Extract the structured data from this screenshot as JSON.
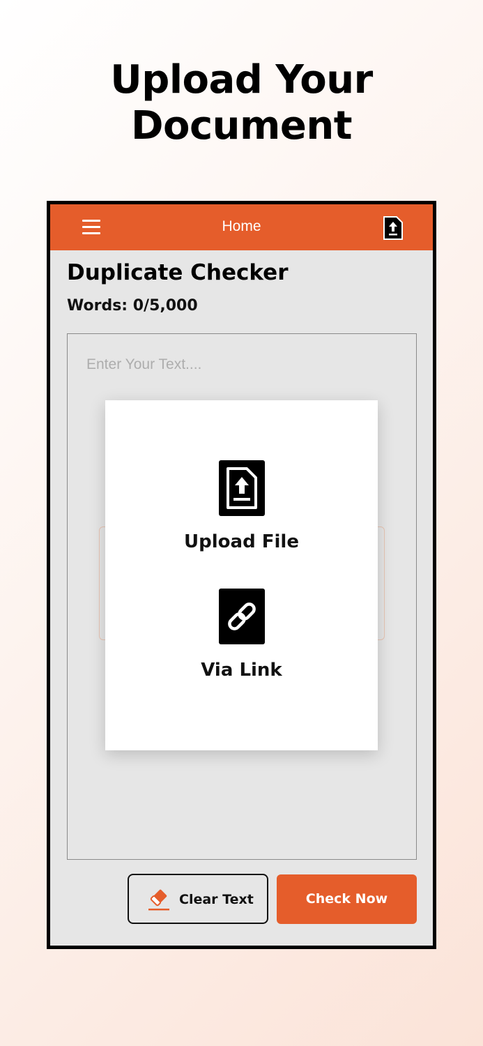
{
  "promo": {
    "headline_line1": "Upload Your",
    "headline_line2": "Document"
  },
  "appbar": {
    "title": "Home",
    "menu_icon": "hamburger-menu-icon",
    "action_icon": "file-upload-icon"
  },
  "page": {
    "title": "Duplicate Checker",
    "word_count": "Words: 0/5,000"
  },
  "editor": {
    "placeholder": "Enter Your Text...."
  },
  "upload_dialog": {
    "options": [
      {
        "label": "Upload File",
        "icon": "file-upload-icon"
      },
      {
        "label": "Via Link",
        "icon": "link-icon"
      }
    ]
  },
  "actions": {
    "clear_label": "Clear Text",
    "clear_icon": "eraser-icon",
    "check_label": "Check Now"
  },
  "colors": {
    "accent": "#e55d2b",
    "surface": "#e6e6e6",
    "text": "#111111"
  }
}
